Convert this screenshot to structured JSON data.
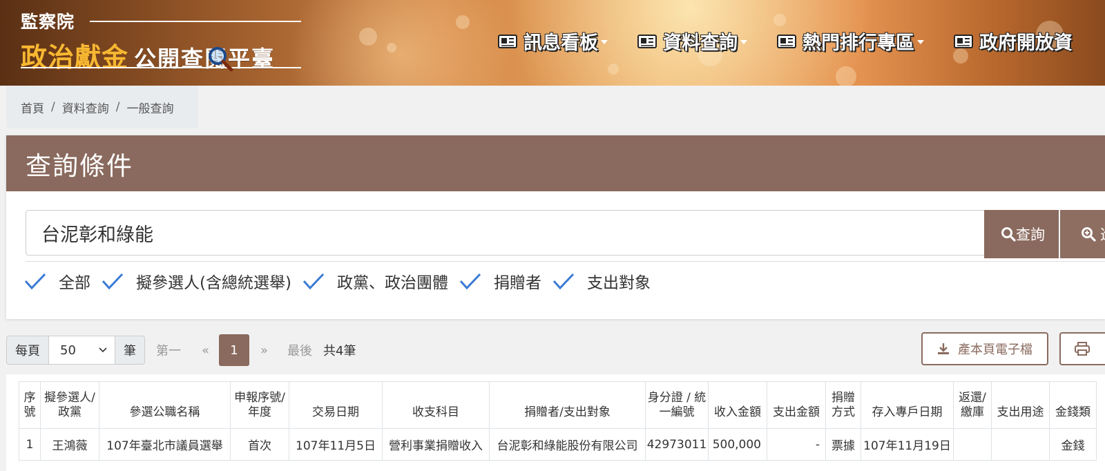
{
  "header": {
    "agency": "監察院",
    "logo_highlight": "政治獻金",
    "logo_rest": "公開查閱平臺",
    "nav": [
      {
        "label": "訊息看板",
        "dropdown": true
      },
      {
        "label": "資料查詢",
        "dropdown": true
      },
      {
        "label": "熱門排行專區",
        "dropdown": true
      },
      {
        "label": "政府開放資",
        "dropdown": false
      }
    ]
  },
  "breadcrumb": [
    "首頁",
    "資料查詢",
    "一般查詢"
  ],
  "query": {
    "title": "查詢條件",
    "search_value": "台泥彰和綠能",
    "search_button": "查詢",
    "advanced_button": "進",
    "filters": [
      "全部",
      "擬參選人(含總統選舉)",
      "政黨、政治團體",
      "捐贈者",
      "支出對象"
    ]
  },
  "pager": {
    "per_page_prefix": "每頁",
    "per_page_value": "50",
    "per_page_suffix": "筆",
    "first": "第一",
    "prev": "«",
    "current": "1",
    "next": "»",
    "last": "最後",
    "total": "共4筆",
    "export_label": "產本頁電子檔"
  },
  "table": {
    "headers": [
      "序號",
      "擬參選人/政黨",
      "參選公職名稱",
      "申報序號/年度",
      "交易日期",
      "收支科目",
      "捐贈者/支出對象",
      "身分證 / 統一編號",
      "收入金額",
      "支出金額",
      "捐贈方式",
      "存入專戶日期",
      "返還/繳庫",
      "支出用途",
      "金錢類"
    ],
    "rows": [
      [
        "1",
        "王鴻薇",
        "107年臺北市議員選舉",
        "首次",
        "107年11月5日",
        "營利事業捐贈收入",
        "台泥彰和綠能股份有限公司",
        "42973011",
        "500,000",
        "-",
        "票據",
        "107年11月19日",
        "",
        "",
        "金錢"
      ]
    ]
  },
  "colors": {
    "brand_brown": "#8a6a5e",
    "logo_gold": "#f7b832",
    "check_blue": "#3a7bd5"
  }
}
